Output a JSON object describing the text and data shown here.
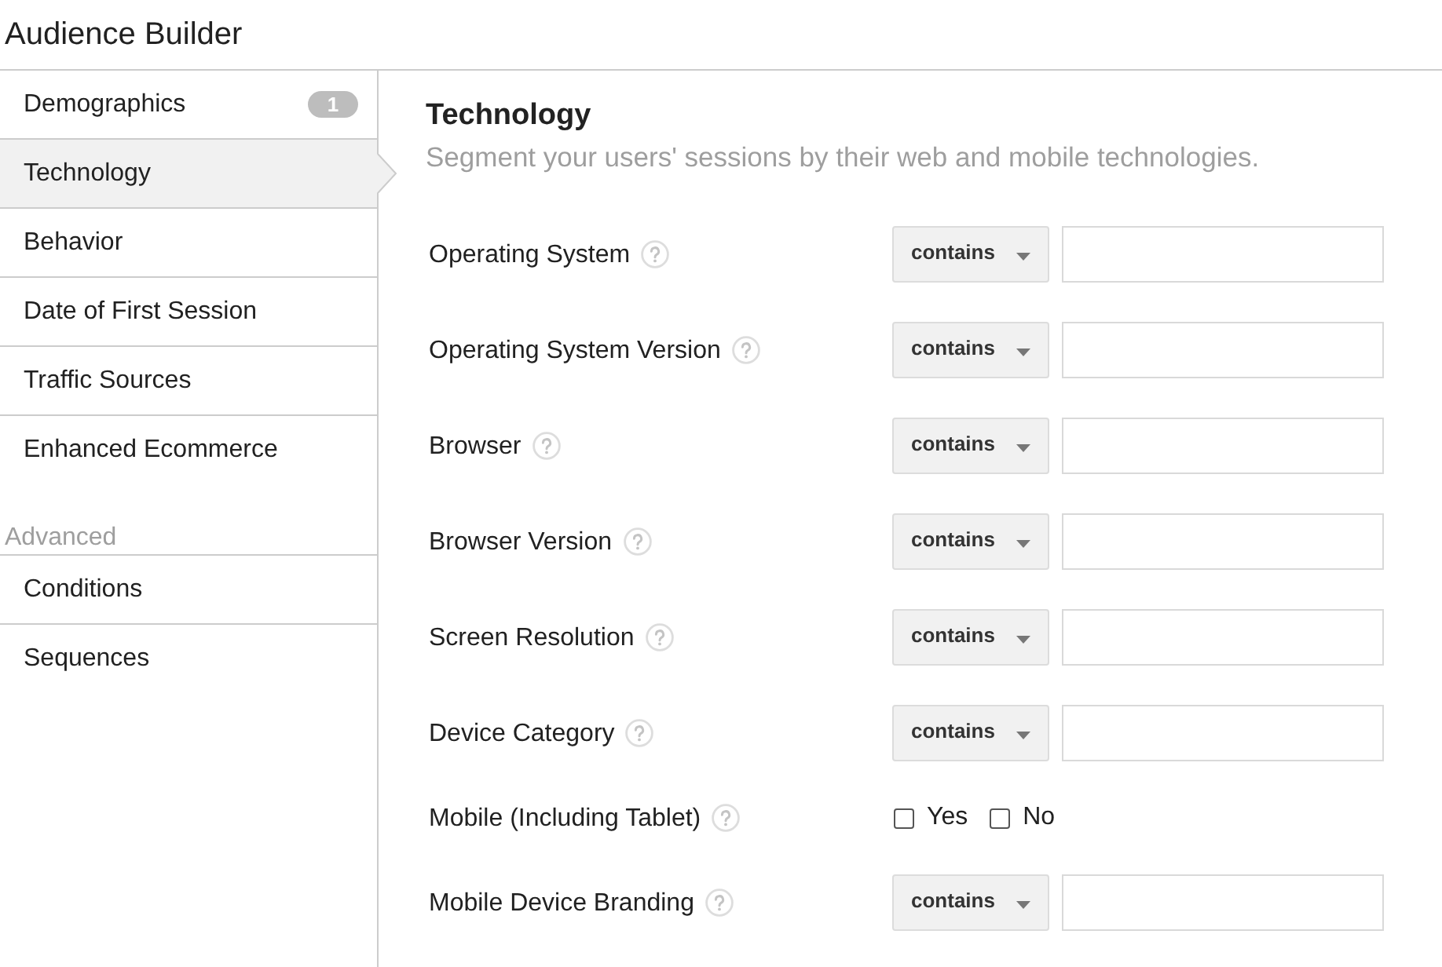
{
  "title": "Audience Builder",
  "sidebar": {
    "items": [
      {
        "label": "Demographics",
        "badge": "1",
        "selected": false
      },
      {
        "label": "Technology",
        "selected": true
      },
      {
        "label": "Behavior",
        "selected": false
      },
      {
        "label": "Date of First Session",
        "selected": false
      },
      {
        "label": "Traffic Sources",
        "selected": false
      },
      {
        "label": "Enhanced Ecommerce",
        "selected": false
      }
    ],
    "advanced": {
      "heading": "Advanced",
      "items": [
        {
          "label": "Conditions",
          "selected": false
        },
        {
          "label": "Sequences",
          "selected": false
        }
      ]
    }
  },
  "panel": {
    "heading": "Technology",
    "subtitle": "Segment your users' sessions by their web and mobile technologies.",
    "fields": [
      {
        "kind": "match",
        "label": "Operating System",
        "operator": "contains"
      },
      {
        "kind": "match",
        "label": "Operating System Version",
        "operator": "contains"
      },
      {
        "kind": "match",
        "label": "Browser",
        "operator": "contains"
      },
      {
        "kind": "match",
        "label": "Browser Version",
        "operator": "contains"
      },
      {
        "kind": "match",
        "label": "Screen Resolution",
        "operator": "contains"
      },
      {
        "kind": "match",
        "label": "Device Category",
        "operator": "contains"
      },
      {
        "kind": "checkboxes",
        "label": "Mobile (Including Tablet)",
        "options": [
          {
            "label": "Yes",
            "checked": false
          },
          {
            "label": "No",
            "checked": false
          }
        ]
      },
      {
        "kind": "match",
        "label": "Mobile Device Branding",
        "operator": "contains"
      }
    ]
  }
}
